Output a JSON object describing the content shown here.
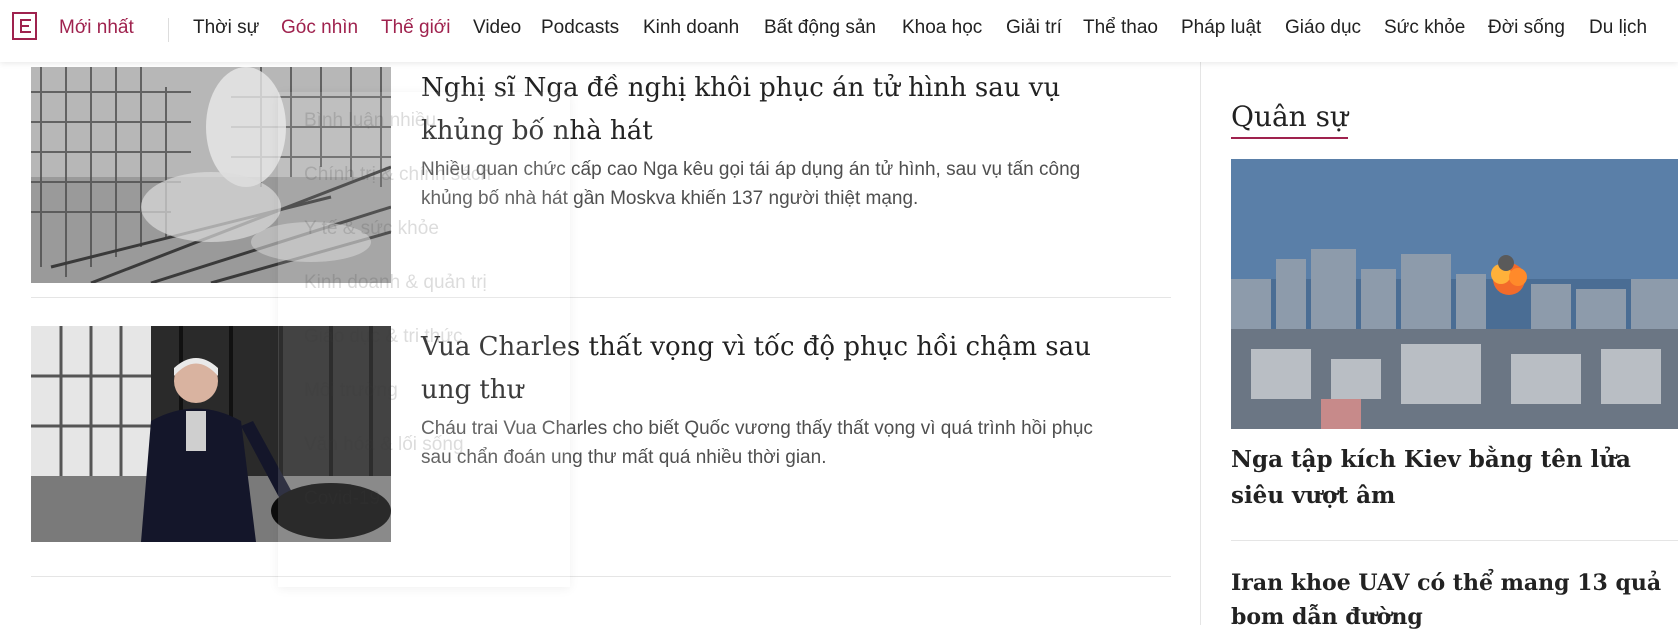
{
  "nav": {
    "latest": "Mới nhất",
    "items": [
      {
        "label": "Thời sự",
        "accent": false
      },
      {
        "label": "Góc nhìn",
        "accent": true
      },
      {
        "label": "Thế giới",
        "accent": true
      },
      {
        "label": "Video",
        "accent": false
      },
      {
        "label": "Podcasts",
        "accent": false
      },
      {
        "label": "Kinh doanh",
        "accent": false
      },
      {
        "label": "Bất động sản",
        "accent": false
      },
      {
        "label": "Khoa học",
        "accent": false
      },
      {
        "label": "Giải trí",
        "accent": false
      },
      {
        "label": "Thể thao",
        "accent": false
      },
      {
        "label": "Pháp luật",
        "accent": false
      },
      {
        "label": "Giáo dục",
        "accent": false
      },
      {
        "label": "Sức khỏe",
        "accent": false
      },
      {
        "label": "Đời sống",
        "accent": false
      },
      {
        "label": "Du lịch",
        "accent": false
      }
    ]
  },
  "dropdown": {
    "items": [
      "Bình luận nhiều",
      "Chính trị & chính sách",
      "Y tế & sức khỏe",
      "Kinh doanh & quản trị",
      "Giáo dục & tri thức",
      "Môi trường",
      "Văn hóa & lối sống",
      "Covid-19"
    ]
  },
  "articles": [
    {
      "title": "Nghị sĩ Nga đề nghị khôi phục án tử hình sau vụ khủng bố nhà hát",
      "description": "Nhiều quan chức cấp cao Nga kêu gọi tái áp dụng án tử hình, sau vụ tấn công khủng bố nhà hát gần Moskva khiến 137 người thiệt mạng."
    },
    {
      "title": "Vua Charles thất vọng vì tốc độ phục hồi chậm sau ung thư",
      "description": "Cháu trai Vua Charles cho biết Quốc vương thấy thất vọng vì quá trình hồi phục sau chẩn đoán ung thư mất quá nhiều thời gian."
    }
  ],
  "sidebar": {
    "section_title": "Quân sự",
    "lead_headline": "Nga tập kích Kiev bằng tên lửa siêu vượt âm",
    "second_headline": "Iran khoe UAV có thể mang 13 quả bom dẫn đường"
  },
  "colors": {
    "brand": "#9f224e"
  }
}
